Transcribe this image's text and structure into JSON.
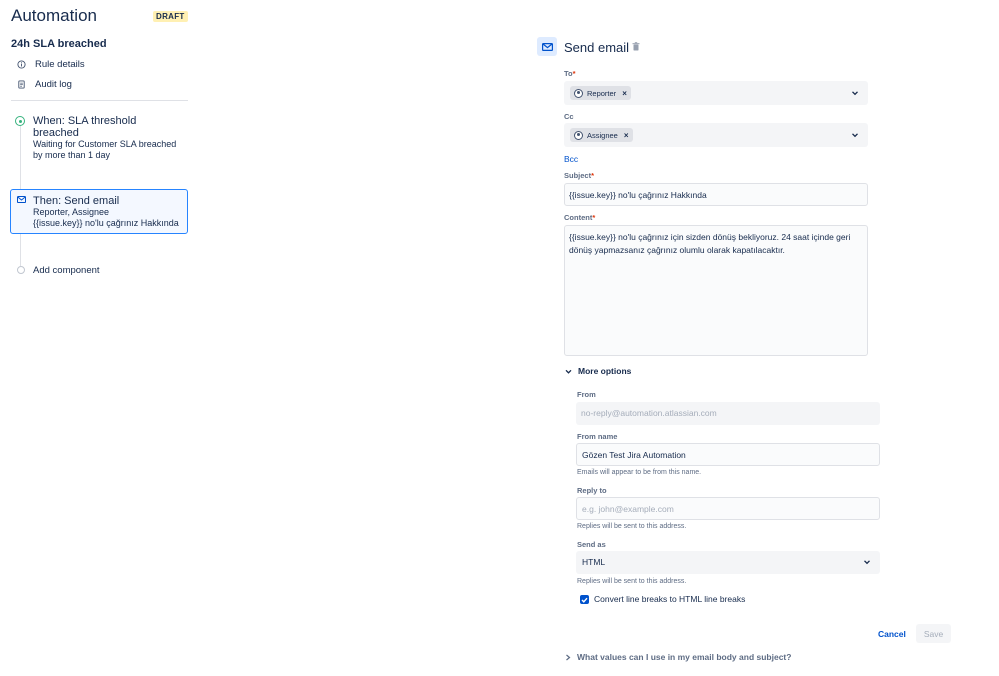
{
  "header": {
    "title": "Automation",
    "badge": "DRAFT"
  },
  "rule": {
    "name": "24h SLA breached"
  },
  "nav": {
    "rule_details": "Rule details",
    "audit_log": "Audit log"
  },
  "steps": {
    "when": {
      "title": "When: SLA threshold breached",
      "description": "Waiting for Customer SLA breached by more than 1 day"
    },
    "then": {
      "title": "Then: Send email",
      "recipients": "Reporter, Assignee",
      "subject": "{{issue.key}} no'lu çağrınız Hakkında"
    },
    "add_component": "Add component"
  },
  "action": {
    "title": "Send email",
    "to": {
      "label": "To",
      "required": "*",
      "chip": "Reporter",
      "remove": "×"
    },
    "cc": {
      "label": "Cc",
      "chip": "Assignee",
      "remove": "×"
    },
    "bcc_link": "Bcc",
    "subject": {
      "label": "Subject",
      "required": "*",
      "value": "{{issue.key}} no'lu çağrınız Hakkında"
    },
    "content": {
      "label": "Content",
      "required": "*",
      "value": "{{issue.key}} no'lu çağrınız için sizden dönüş bekliyoruz. 24 saat içinde geri dönüş yapmazsanız çağrınız olumlu olarak kapatılacaktır."
    },
    "more_options": "More options",
    "from": {
      "label": "From",
      "placeholder": "no-reply@automation.atlassian.com"
    },
    "from_name": {
      "label": "From name",
      "value": "Gözen Test Jira Automation",
      "helper": "Emails will appear to be from this name."
    },
    "reply_to": {
      "label": "Reply to",
      "placeholder": "e.g. john@example.com",
      "helper": "Replies will be sent to this address."
    },
    "send_as": {
      "label": "Send as",
      "value": "HTML",
      "helper": "Replies will be sent to this address."
    },
    "convert_line_breaks": "Convert line breaks to HTML line breaks",
    "cancel": "Cancel",
    "save": "Save",
    "values_help": "What values can I use in my email body and subject?"
  },
  "colors": {
    "accent": "#0052cc",
    "selected_border": "#2684ff",
    "success": "#36b37e",
    "required": "#de350b",
    "draft_badge": "#fff0b3"
  },
  "icons": {
    "rule_details": "info-icon",
    "audit_log": "document-icon",
    "when": "clock-icon",
    "then": "mail-icon",
    "delete": "trash-icon",
    "expand": "chevron-down-icon",
    "collapse": "chevron-right-icon"
  }
}
